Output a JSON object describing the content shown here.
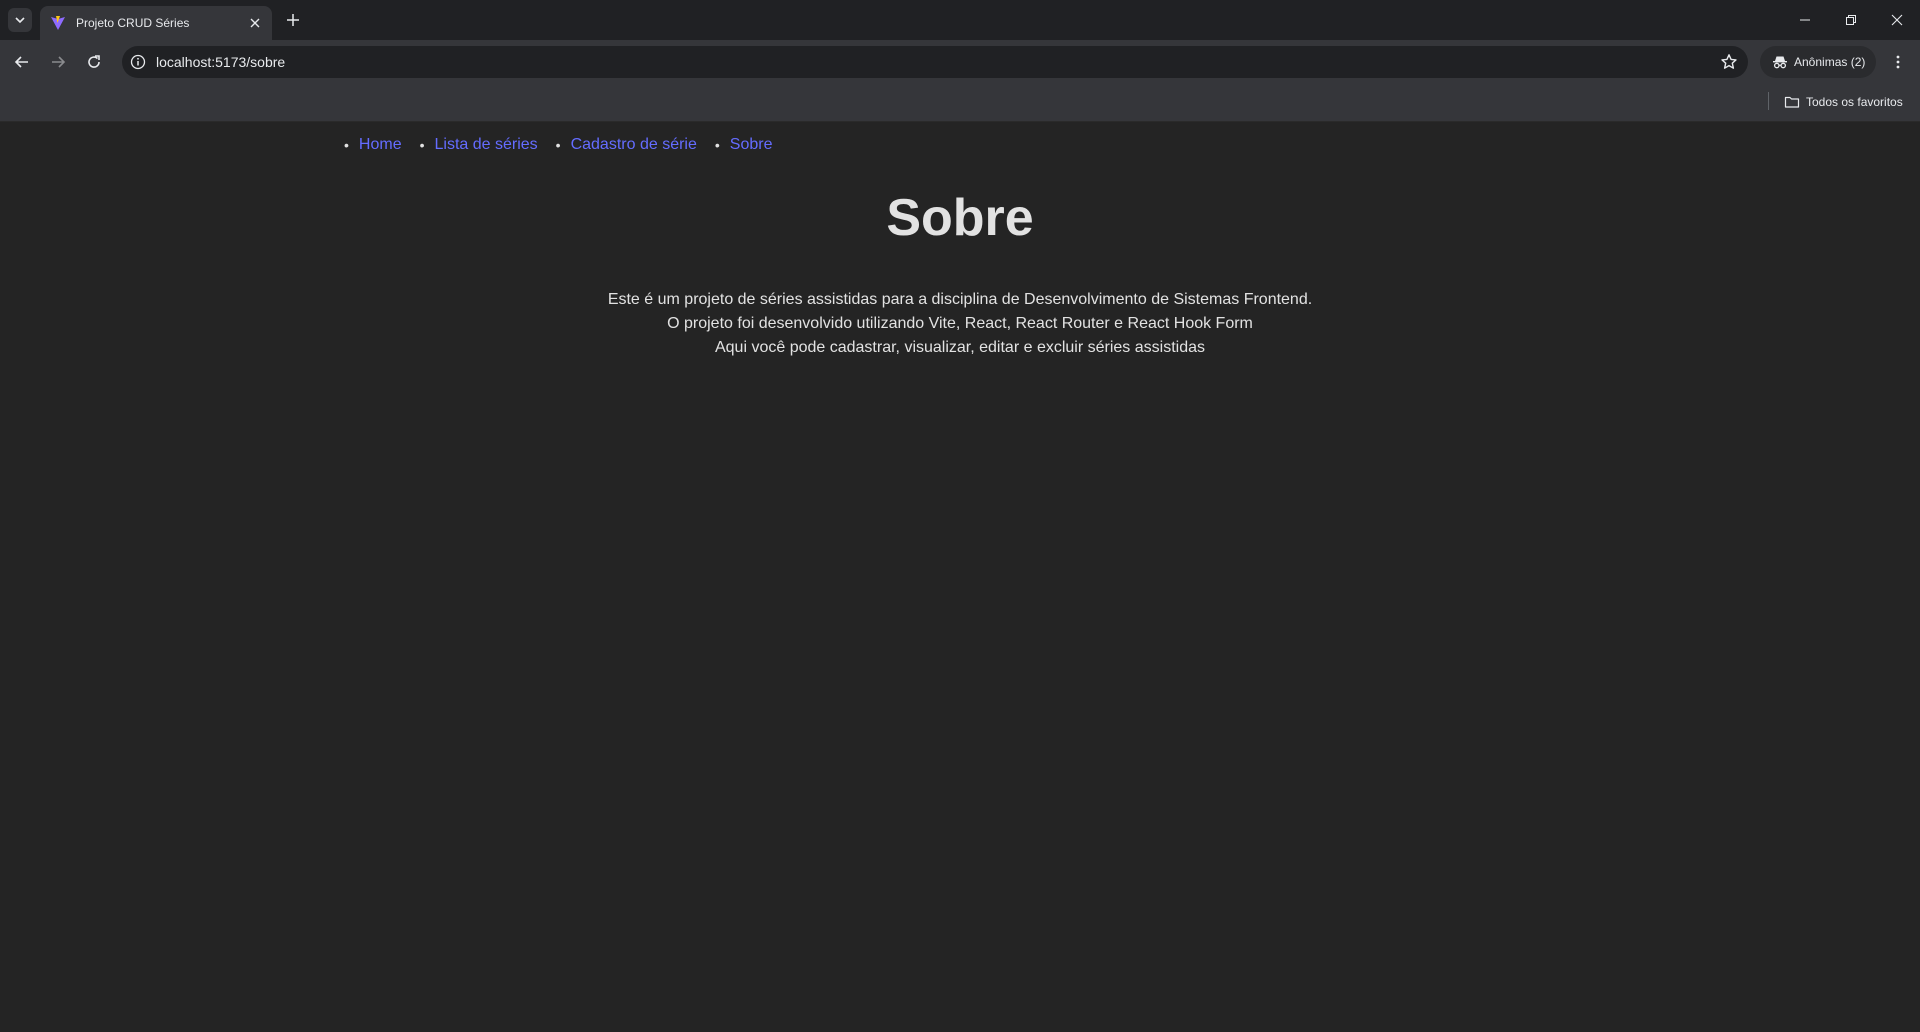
{
  "browser": {
    "tab": {
      "title": "Projeto CRUD Séries"
    },
    "address_bar": {
      "url": "localhost:5173/sobre"
    },
    "profile": {
      "label": "Anônimas (2)"
    },
    "bookmarks": {
      "all_bookmarks_label": "Todos os favoritos"
    }
  },
  "page": {
    "nav": {
      "items": [
        {
          "label": "Home"
        },
        {
          "label": "Lista de séries"
        },
        {
          "label": "Cadastro de série"
        },
        {
          "label": "Sobre"
        }
      ],
      "link_color": "#646cff"
    },
    "title": "Sobre",
    "paragraph_lines": [
      "Este é um projeto de séries assistidas para a disciplina de Desenvolvimento de Sistemas Frontend.",
      "O projeto foi desenvolvido utilizando Vite, React, React Router e React Hook Form",
      "Aqui você pode cadastrar, visualizar, editar e excluir séries assistidas"
    ]
  },
  "colors": {
    "page_background": "#242424",
    "chrome_background": "#202124",
    "toolbar_background": "#35363a"
  },
  "icons": {
    "tab_search": "chevron-down-icon",
    "favicon": "vite-logo-icon",
    "tab_close": "close-icon",
    "new_tab": "plus-icon",
    "back": "arrow-left-icon",
    "forward": "arrow-right-icon",
    "reload": "reload-icon",
    "site_info": "info-icon",
    "bookmark": "star-icon",
    "incognito": "incognito-icon",
    "menu": "more-vertical-icon",
    "folder": "folder-icon"
  }
}
